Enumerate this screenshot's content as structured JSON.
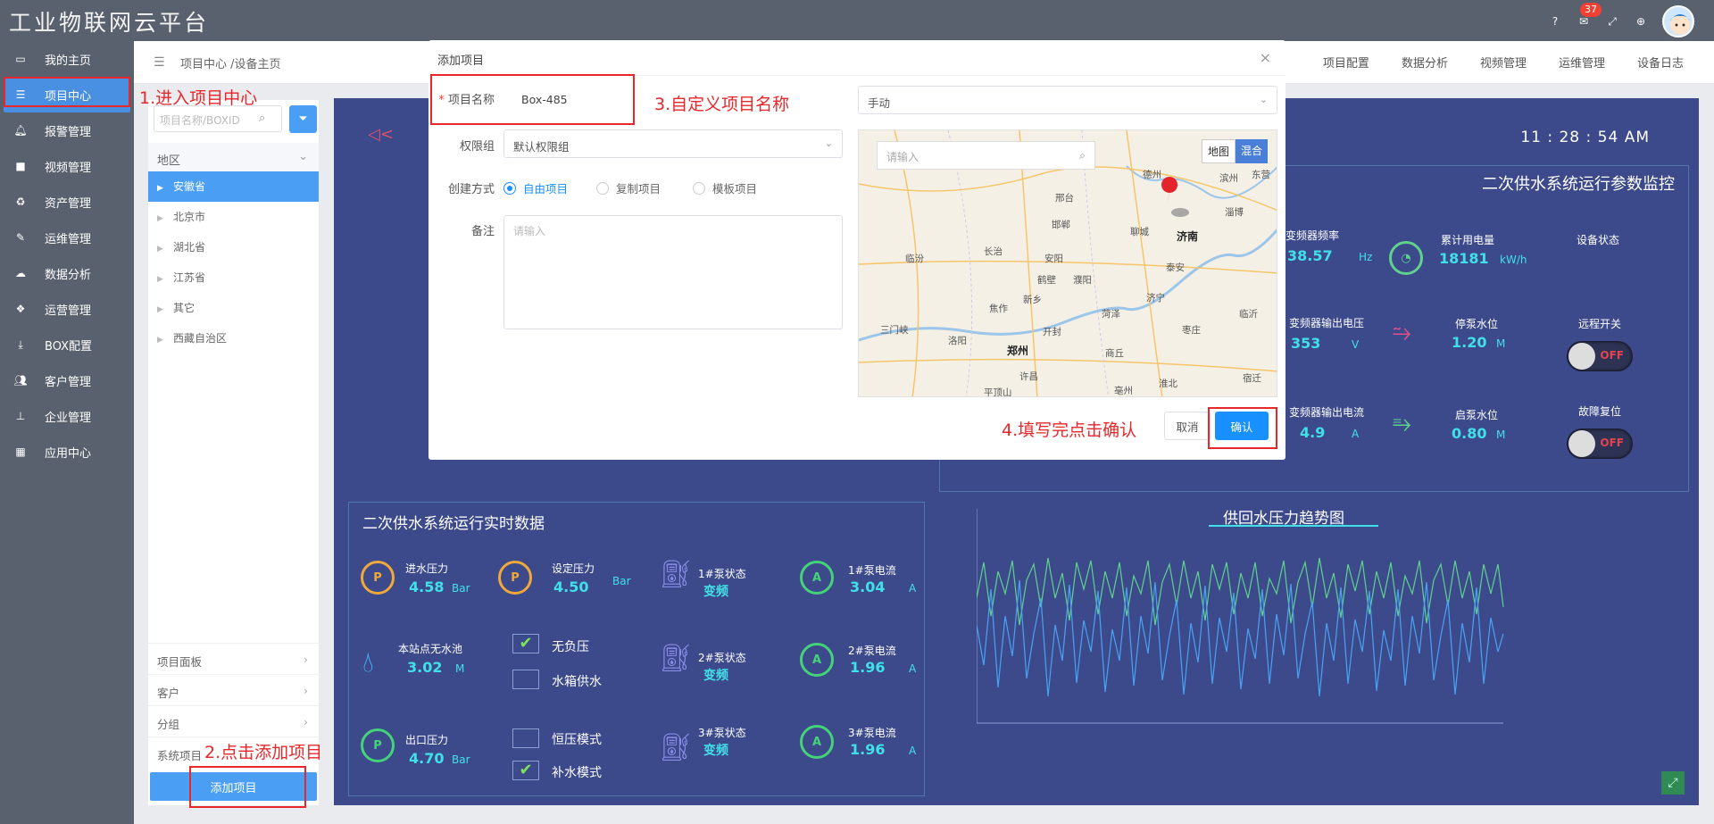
{
  "app": {
    "title": "工业物联网云平台",
    "notification_count": "37"
  },
  "sidebar": {
    "items": [
      {
        "label": "我的主页",
        "icon": "laptop-icon"
      },
      {
        "label": "项目中心",
        "icon": "list-icon"
      },
      {
        "label": "报警管理",
        "icon": "bell-icon"
      },
      {
        "label": "视频管理",
        "icon": "video-icon"
      },
      {
        "label": "资产管理",
        "icon": "recycle-icon"
      },
      {
        "label": "运维管理",
        "icon": "wrench-icon"
      },
      {
        "label": "数据分析",
        "icon": "cloud-icon"
      },
      {
        "label": "运营管理",
        "icon": "cubes-icon"
      },
      {
        "label": "BOX配置",
        "icon": "download-icon"
      },
      {
        "label": "客户管理",
        "icon": "users-icon"
      },
      {
        "label": "企业管理",
        "icon": "sitemap-icon"
      },
      {
        "label": "应用中心",
        "icon": "grid-icon"
      }
    ]
  },
  "breadcrumb": "项目中心 /设备主页",
  "topnav": [
    "项目配置",
    "数据分析",
    "视频管理",
    "运维管理",
    "设备日志"
  ],
  "leftpanel": {
    "search_placeholder": "项目名称/BOXID",
    "region_label": "地区",
    "regions": [
      "安徽省",
      "北京市",
      "湖北省",
      "江苏省",
      "其它",
      "西藏自治区"
    ],
    "accordions": [
      "项目面板",
      "客户",
      "分组",
      "系统项目"
    ],
    "add_button": "添加项目"
  },
  "annotations": {
    "step1": "1.进入项目中心",
    "step2": "2.点击添加项目",
    "step3": "3.自定义项目名称",
    "step4": "4.填写完点击确认"
  },
  "dashboard": {
    "time": "11 : 28 : 54 AM",
    "monitor_title": "二次供水系统运行参数监控",
    "realtime_title": "二次供水系统运行实时数据",
    "trend_title": "供回水压力趋势图",
    "monitor": {
      "freq_label": "变频器频率",
      "freq_value": "38.57",
      "freq_unit": "Hz",
      "energy_label": "累计用电量",
      "energy_value": "18181",
      "energy_unit": "kW/h",
      "status_label": "设备状态",
      "volt_label": "变频器输出电压",
      "volt_value": "353",
      "volt_unit": "V",
      "stop_level_label": "停泵水位",
      "stop_level_value": "1.20",
      "stop_level_unit": "M",
      "remote_label": "远程开关",
      "remote_state": "OFF",
      "curr_label": "变频器输出电流",
      "curr_value": "4.9",
      "curr_unit": "A",
      "start_level_label": "启泵水位",
      "start_level_value": "0.80",
      "start_level_unit": "M",
      "reset_label": "故障复位",
      "reset_state": "OFF"
    },
    "realtime": {
      "in_pressure_label": "进水压力",
      "in_pressure_value": "4.58",
      "in_pressure_unit": "Bar",
      "set_pressure_label": "设定压力",
      "set_pressure_value": "4.50",
      "set_pressure_unit": "Bar",
      "pump1_label": "1#泵状态",
      "pump1_state": "变频",
      "pump1_curr_label": "1#泵电流",
      "pump1_curr_value": "3.04",
      "pump1_curr_unit": "A",
      "pool_label": "本站点无水池",
      "pool_value": "3.02",
      "pool_unit": "M",
      "no_neg_label": "无负压",
      "tank_label": "水箱供水",
      "pump2_label": "2#泵状态",
      "pump2_state": "变频",
      "pump2_curr_label": "2#泵电流",
      "pump2_curr_value": "1.96",
      "pump2_curr_unit": "A",
      "out_pressure_label": "出口压力",
      "out_pressure_value": "4.70",
      "out_pressure_unit": "Bar",
      "const_label": "恒压模式",
      "supp_label": "补水模式",
      "pump3_label": "3#泵状态",
      "pump3_state": "变频",
      "pump3_curr_label": "3#泵电流",
      "pump3_curr_value": "1.96",
      "pump3_curr_unit": "A"
    }
  },
  "modal": {
    "title": "添加项目",
    "name_label": "项目名称",
    "name_value": "Box-485",
    "mode_value": "手动",
    "perm_label": "权限组",
    "perm_value": "默认权限组",
    "create_label": "创建方式",
    "create_options": [
      "自由项目",
      "复制项目",
      "模板项目"
    ],
    "note_label": "备注",
    "note_placeholder": "请输入",
    "map_search_placeholder": "请输入",
    "map_tab_map": "地图",
    "map_tab_hybrid": "混合",
    "cancel": "取消",
    "confirm": "确认",
    "cities": [
      "德州",
      "滨州",
      "东营",
      "邢台",
      "淄博",
      "邯郸",
      "聊城",
      "济南",
      "临汾",
      "长治",
      "安阳",
      "鹤壁",
      "泰安",
      "濮阳",
      "新乡",
      "济宁",
      "焦作",
      "菏泽",
      "枣庄",
      "三门峡",
      "洛阳",
      "开封",
      "临沂",
      "郑州",
      "许昌",
      "商丘",
      "平顶山",
      "亳州",
      "淮北",
      "宿迁"
    ]
  },
  "colors": {
    "accent": "#4a9ff5",
    "sidebar": "#59616e",
    "dashboard": "#3c4a8c",
    "annotation": "#e8272b",
    "primary": "#1890ff"
  }
}
